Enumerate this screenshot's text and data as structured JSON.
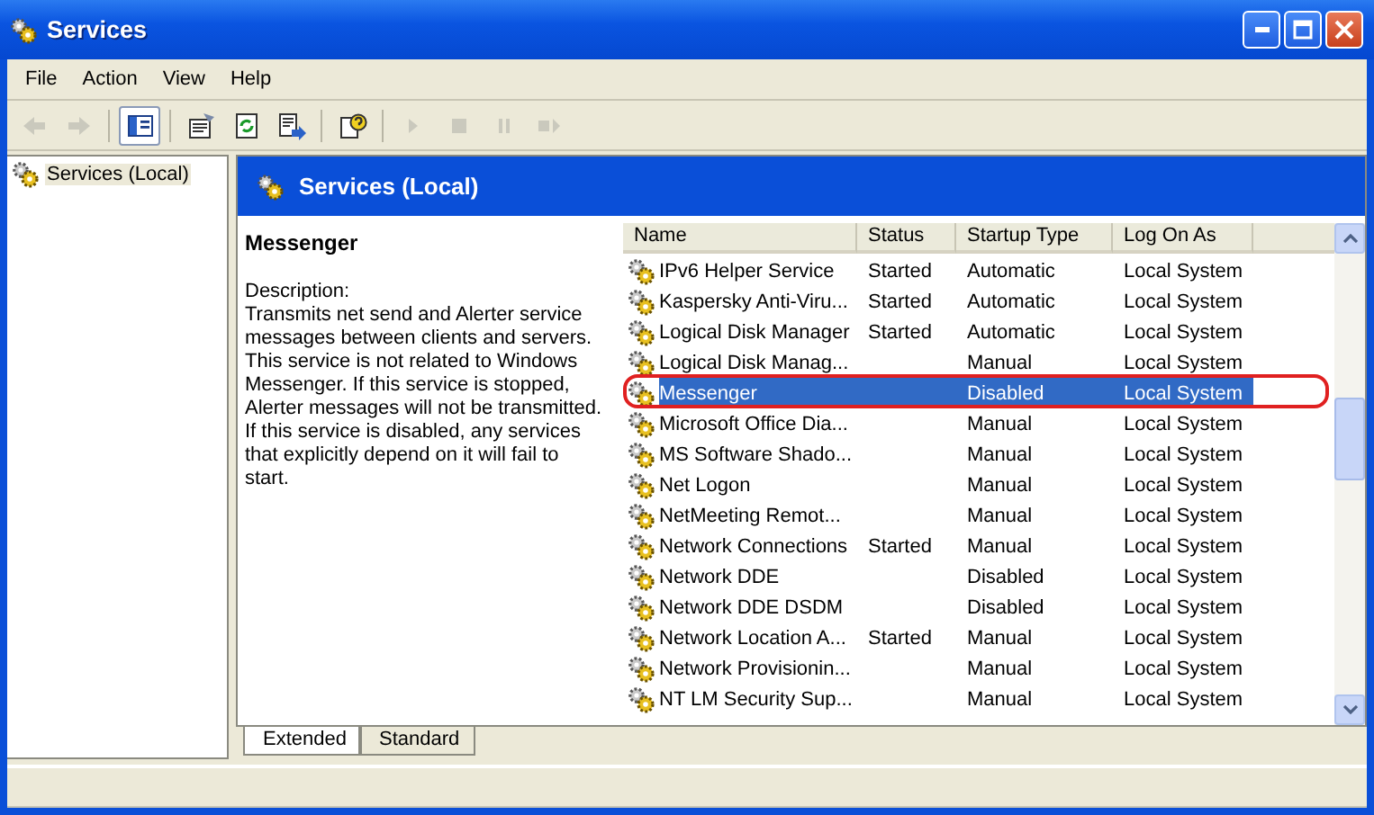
{
  "window": {
    "title": "Services"
  },
  "menu": [
    "File",
    "Action",
    "View",
    "Help"
  ],
  "toolbar": [
    {
      "kind": "back",
      "disabled": true,
      "pressed": false
    },
    {
      "kind": "forward",
      "disabled": true,
      "pressed": false
    },
    {
      "kind": "tree",
      "disabled": false,
      "pressed": true
    },
    {
      "kind": "properties",
      "disabled": false,
      "pressed": false
    },
    {
      "kind": "refresh",
      "disabled": false,
      "pressed": false
    },
    {
      "kind": "export",
      "disabled": false,
      "pressed": false
    },
    {
      "kind": "help",
      "disabled": false,
      "pressed": false
    },
    {
      "kind": "start",
      "disabled": true,
      "pressed": false
    },
    {
      "kind": "stop",
      "disabled": true,
      "pressed": false
    },
    {
      "kind": "pause",
      "disabled": true,
      "pressed": false
    },
    {
      "kind": "restart",
      "disabled": true,
      "pressed": false
    }
  ],
  "tree": {
    "items": [
      {
        "label": "Services (Local)",
        "selected": true
      }
    ]
  },
  "panel": {
    "title": "Services (Local)"
  },
  "details": {
    "name": "Messenger",
    "heading": "Description:",
    "description": "Transmits net send and Alerter service messages between clients and servers. This service is not related to Windows Messenger. If this service is stopped, Alerter messages will not be transmitted. If this service is disabled, any services that explicitly depend on it will fail to start."
  },
  "table": {
    "columns": [
      "Name",
      "Status",
      "Startup Type",
      "Log On As"
    ],
    "rows": [
      {
        "name": "IPv6 Helper Service",
        "status": "Started",
        "startup": "Automatic",
        "logon": "Local System",
        "selected": false
      },
      {
        "name": "Kaspersky Anti-Viru...",
        "status": "Started",
        "startup": "Automatic",
        "logon": "Local System",
        "selected": false
      },
      {
        "name": "Logical Disk Manager",
        "status": "Started",
        "startup": "Automatic",
        "logon": "Local System",
        "selected": false
      },
      {
        "name": "Logical Disk Manag...",
        "status": "",
        "startup": "Manual",
        "logon": "Local System",
        "selected": false
      },
      {
        "name": "Messenger",
        "status": "",
        "startup": "Disabled",
        "logon": "Local System",
        "selected": true
      },
      {
        "name": "Microsoft Office Dia...",
        "status": "",
        "startup": "Manual",
        "logon": "Local System",
        "selected": false
      },
      {
        "name": "MS Software Shado...",
        "status": "",
        "startup": "Manual",
        "logon": "Local System",
        "selected": false
      },
      {
        "name": "Net Logon",
        "status": "",
        "startup": "Manual",
        "logon": "Local System",
        "selected": false
      },
      {
        "name": "NetMeeting Remot...",
        "status": "",
        "startup": "Manual",
        "logon": "Local System",
        "selected": false
      },
      {
        "name": "Network Connections",
        "status": "Started",
        "startup": "Manual",
        "logon": "Local System",
        "selected": false
      },
      {
        "name": "Network DDE",
        "status": "",
        "startup": "Disabled",
        "logon": "Local System",
        "selected": false
      },
      {
        "name": "Network DDE DSDM",
        "status": "",
        "startup": "Disabled",
        "logon": "Local System",
        "selected": false
      },
      {
        "name": "Network Location A...",
        "status": "Started",
        "startup": "Manual",
        "logon": "Local System",
        "selected": false
      },
      {
        "name": "Network Provisionin...",
        "status": "",
        "startup": "Manual",
        "logon": "Local System",
        "selected": false
      },
      {
        "name": "NT LM Security Sup...",
        "status": "",
        "startup": "Manual",
        "logon": "Local System",
        "selected": false
      }
    ]
  },
  "tabs": [
    {
      "label": "Extended",
      "selected": true
    },
    {
      "label": "Standard",
      "selected": false
    }
  ]
}
